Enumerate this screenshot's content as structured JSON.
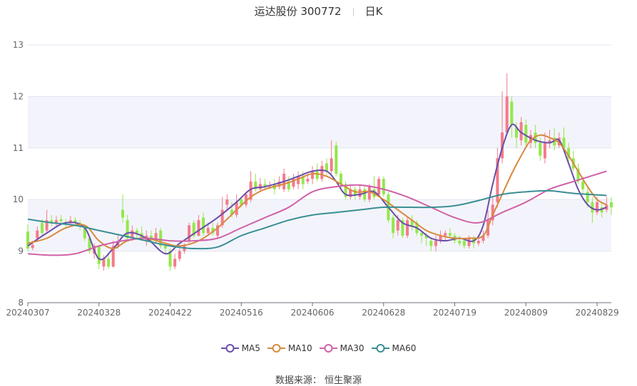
{
  "header": {
    "title": "运达股份 300772",
    "period": "日K"
  },
  "source_text": "数据来源： 恒生聚源",
  "colors": {
    "up": "#f47a8a",
    "down": "#92e84c",
    "MA5": "#6a4ea8",
    "MA10": "#d8893e",
    "MA30": "#d062a8",
    "MA60": "#3a8e94",
    "band": "#f3f4fb",
    "grid": "#e0e6f0"
  },
  "chart_data": {
    "type": "candlestick",
    "y_ticks": [
      "8",
      "9",
      "10",
      "11",
      "12",
      "13"
    ],
    "ylim": [
      8,
      13
    ],
    "x_tick_labels": [
      "20240307",
      "20240328",
      "20240422",
      "20240516",
      "20240606",
      "20240628",
      "20240719",
      "20240809",
      "20240829"
    ],
    "x_tick_index": [
      0,
      15,
      30,
      45,
      60,
      75,
      90,
      105,
      120
    ],
    "candles": [
      [
        9.38,
        9.05,
        9.52,
        9.0
      ],
      [
        9.06,
        9.12,
        9.2,
        9.02
      ],
      [
        9.25,
        9.4,
        9.48,
        9.2
      ],
      [
        9.55,
        9.35,
        9.62,
        9.3
      ],
      [
        9.4,
        9.6,
        9.8,
        9.35
      ],
      [
        9.6,
        9.55,
        9.7,
        9.48
      ],
      [
        9.55,
        9.6,
        9.68,
        9.48
      ],
      [
        9.62,
        9.58,
        9.7,
        9.5
      ],
      [
        9.55,
        9.52,
        9.62,
        9.45
      ],
      [
        9.55,
        9.6,
        9.68,
        9.5
      ],
      [
        9.6,
        9.55,
        9.66,
        9.48
      ],
      [
        9.55,
        9.5,
        9.6,
        9.4
      ],
      [
        9.45,
        9.25,
        9.5,
        9.2
      ],
      [
        9.25,
        9.0,
        9.3,
        8.95
      ],
      [
        8.95,
        9.1,
        9.15,
        8.85
      ],
      [
        9.1,
        8.75,
        9.12,
        8.65
      ],
      [
        8.7,
        8.85,
        8.92,
        8.62
      ],
      [
        8.85,
        8.7,
        8.95,
        8.65
      ],
      [
        8.7,
        9.1,
        9.2,
        8.68
      ],
      [
        9.1,
        9.2,
        9.3,
        9.05
      ],
      [
        9.8,
        9.65,
        10.1,
        9.55
      ],
      [
        9.6,
        9.25,
        9.7,
        9.2
      ],
      [
        9.25,
        9.4,
        9.5,
        9.2
      ],
      [
        9.4,
        9.35,
        9.45,
        9.25
      ],
      [
        9.35,
        9.25,
        9.48,
        9.2
      ],
      [
        9.2,
        9.3,
        9.4,
        9.1
      ],
      [
        9.3,
        9.2,
        9.4,
        9.15
      ],
      [
        9.2,
        9.35,
        9.45,
        9.15
      ],
      [
        9.4,
        9.1,
        9.45,
        9.05
      ],
      [
        9.1,
        9.05,
        9.15,
        8.95
      ],
      [
        9.0,
        8.7,
        9.05,
        8.62
      ],
      [
        8.7,
        8.85,
        8.95,
        8.65
      ],
      [
        8.85,
        9.0,
        9.05,
        8.8
      ],
      [
        9.0,
        9.1,
        9.15,
        8.95
      ],
      [
        9.2,
        9.5,
        9.55,
        9.15
      ],
      [
        9.55,
        9.3,
        9.6,
        9.25
      ],
      [
        9.3,
        9.6,
        9.7,
        9.28
      ],
      [
        9.65,
        9.35,
        9.75,
        9.3
      ],
      [
        9.35,
        9.45,
        9.55,
        9.3
      ],
      [
        9.45,
        9.35,
        9.55,
        9.3
      ],
      [
        9.3,
        9.5,
        9.55,
        9.25
      ],
      [
        9.5,
        9.8,
        10.05,
        9.45
      ],
      [
        9.9,
        10.0,
        10.1,
        9.8
      ],
      [
        9.8,
        9.7,
        9.95,
        9.65
      ],
      [
        9.7,
        9.95,
        10.1,
        9.65
      ],
      [
        10.0,
        9.9,
        10.05,
        9.85
      ],
      [
        9.9,
        10.1,
        10.15,
        9.85
      ],
      [
        10.0,
        10.35,
        10.55,
        9.95
      ],
      [
        10.35,
        10.2,
        10.5,
        10.15
      ],
      [
        10.2,
        10.3,
        10.42,
        10.15
      ],
      [
        10.3,
        10.25,
        10.4,
        10.18
      ],
      [
        10.25,
        10.25,
        10.35,
        10.2
      ],
      [
        10.3,
        10.2,
        10.4,
        10.1
      ],
      [
        10.25,
        10.35,
        10.45,
        10.2
      ],
      [
        10.2,
        10.5,
        10.6,
        10.15
      ],
      [
        10.35,
        10.2,
        10.45,
        10.15
      ],
      [
        10.25,
        10.4,
        10.5,
        10.2
      ],
      [
        10.3,
        10.45,
        10.55,
        10.2
      ],
      [
        10.45,
        10.3,
        10.55,
        10.2
      ],
      [
        10.35,
        10.4,
        10.5,
        10.3
      ],
      [
        10.4,
        10.55,
        10.65,
        10.3
      ],
      [
        10.55,
        10.4,
        10.7,
        10.35
      ],
      [
        10.4,
        10.65,
        10.75,
        10.35
      ],
      [
        10.7,
        10.55,
        10.8,
        10.45
      ],
      [
        10.55,
        10.8,
        11.15,
        10.5
      ],
      [
        11.05,
        10.5,
        11.12,
        10.45
      ],
      [
        10.5,
        10.3,
        10.55,
        10.2
      ],
      [
        10.3,
        10.05,
        10.35,
        10.0
      ],
      [
        10.05,
        10.2,
        10.3,
        10.0
      ],
      [
        10.2,
        10.1,
        10.25,
        10.0
      ],
      [
        10.05,
        10.2,
        10.3,
        10.0
      ],
      [
        10.2,
        10.0,
        10.25,
        9.95
      ],
      [
        10.0,
        10.25,
        10.3,
        9.95
      ],
      [
        10.2,
        10.05,
        10.45,
        10.0
      ],
      [
        10.1,
        10.4,
        10.45,
        10.05
      ],
      [
        10.4,
        10.1,
        10.45,
        10.05
      ],
      [
        10.1,
        9.6,
        10.15,
        9.55
      ],
      [
        9.65,
        9.35,
        9.7,
        9.25
      ],
      [
        9.4,
        9.6,
        9.7,
        9.3
      ],
      [
        9.6,
        9.3,
        9.65,
        9.25
      ],
      [
        9.3,
        9.6,
        9.65,
        9.25
      ],
      [
        9.6,
        9.5,
        9.7,
        9.4
      ],
      [
        9.55,
        9.35,
        9.6,
        9.3
      ],
      [
        9.35,
        9.3,
        9.4,
        9.15
      ],
      [
        9.3,
        9.25,
        9.35,
        9.1
      ],
      [
        9.2,
        9.1,
        9.25,
        9.0
      ],
      [
        9.1,
        9.2,
        9.3,
        9.0
      ],
      [
        9.2,
        9.3,
        9.4,
        9.15
      ],
      [
        9.3,
        9.35,
        9.4,
        9.2
      ],
      [
        9.35,
        9.3,
        9.45,
        9.25
      ],
      [
        9.3,
        9.2,
        9.35,
        9.15
      ],
      [
        9.2,
        9.15,
        9.3,
        9.1
      ],
      [
        9.2,
        9.1,
        9.25,
        9.05
      ],
      [
        9.1,
        9.25,
        9.3,
        9.05
      ],
      [
        9.25,
        9.15,
        9.3,
        9.05
      ],
      [
        9.15,
        9.2,
        9.3,
        9.1
      ],
      [
        9.2,
        9.3,
        9.4,
        9.15
      ],
      [
        9.3,
        9.6,
        9.8,
        9.25
      ],
      [
        9.6,
        9.9,
        10.05,
        9.5
      ],
      [
        9.95,
        10.8,
        11.0,
        9.85
      ],
      [
        10.8,
        11.3,
        12.1,
        10.7
      ],
      [
        11.3,
        12.0,
        12.45,
        11.25
      ],
      [
        11.9,
        11.45,
        12.0,
        11.2
      ],
      [
        11.4,
        11.2,
        11.5,
        11.0
      ],
      [
        11.15,
        11.5,
        11.6,
        11.05
      ],
      [
        11.45,
        11.1,
        11.55,
        11.0
      ],
      [
        11.1,
        11.25,
        11.35,
        11.0
      ],
      [
        11.3,
        11.1,
        11.45,
        11.0
      ],
      [
        11.1,
        10.85,
        11.2,
        10.75
      ],
      [
        10.8,
        11.1,
        11.3,
        10.7
      ],
      [
        11.1,
        11.15,
        11.35,
        11.0
      ],
      [
        11.2,
        11.05,
        11.38,
        10.95
      ],
      [
        11.05,
        11.2,
        11.3,
        11.0
      ],
      [
        11.2,
        11.0,
        11.4,
        10.95
      ],
      [
        11.0,
        10.8,
        11.1,
        10.7
      ],
      [
        10.8,
        10.6,
        10.95,
        10.55
      ],
      [
        10.6,
        10.35,
        10.7,
        10.3
      ],
      [
        10.35,
        10.2,
        10.45,
        10.1
      ],
      [
        10.15,
        9.95,
        10.25,
        9.85
      ],
      [
        9.95,
        9.75,
        10.05,
        9.55
      ],
      [
        9.75,
        9.95,
        10.05,
        9.7
      ],
      [
        9.85,
        9.75,
        9.95,
        9.65
      ],
      [
        9.8,
        9.9,
        10.05,
        9.75
      ],
      [
        9.95,
        9.85,
        10.05,
        9.7
      ]
    ],
    "series": [
      {
        "name": "MA5",
        "points": [
          [
            0,
            9.1
          ],
          [
            4,
            9.35
          ],
          [
            8,
            9.55
          ],
          [
            12,
            9.45
          ],
          [
            15,
            8.85
          ],
          [
            18,
            9.05
          ],
          [
            21,
            9.35
          ],
          [
            25,
            9.25
          ],
          [
            29,
            8.95
          ],
          [
            32,
            9.15
          ],
          [
            36,
            9.4
          ],
          [
            40,
            9.65
          ],
          [
            44,
            9.95
          ],
          [
            47,
            10.2
          ],
          [
            50,
            10.25
          ],
          [
            54,
            10.35
          ],
          [
            57,
            10.45
          ],
          [
            60,
            10.55
          ],
          [
            63,
            10.55
          ],
          [
            65,
            10.35
          ],
          [
            67,
            10.1
          ],
          [
            70,
            10.1
          ],
          [
            73,
            10.15
          ],
          [
            76,
            9.85
          ],
          [
            79,
            9.55
          ],
          [
            82,
            9.45
          ],
          [
            85,
            9.25
          ],
          [
            88,
            9.2
          ],
          [
            91,
            9.25
          ],
          [
            94,
            9.2
          ],
          [
            96,
            9.5
          ],
          [
            98,
            10.3
          ],
          [
            100,
            11.0
          ],
          [
            102,
            11.45
          ],
          [
            104,
            11.3
          ],
          [
            107,
            11.15
          ],
          [
            110,
            11.1
          ],
          [
            112,
            11.15
          ],
          [
            114,
            10.7
          ],
          [
            116,
            10.2
          ],
          [
            118,
            9.9
          ],
          [
            120,
            9.8
          ],
          [
            122,
            9.85
          ]
        ]
      },
      {
        "name": "MA10",
        "points": [
          [
            0,
            9.15
          ],
          [
            4,
            9.25
          ],
          [
            8,
            9.45
          ],
          [
            12,
            9.5
          ],
          [
            15,
            9.2
          ],
          [
            18,
            9.05
          ],
          [
            21,
            9.2
          ],
          [
            25,
            9.25
          ],
          [
            29,
            9.15
          ],
          [
            32,
            9.1
          ],
          [
            36,
            9.2
          ],
          [
            40,
            9.45
          ],
          [
            44,
            9.8
          ],
          [
            47,
            10.05
          ],
          [
            50,
            10.2
          ],
          [
            54,
            10.3
          ],
          [
            57,
            10.4
          ],
          [
            60,
            10.5
          ],
          [
            63,
            10.45
          ],
          [
            66,
            10.3
          ],
          [
            69,
            10.15
          ],
          [
            72,
            10.15
          ],
          [
            75,
            10.0
          ],
          [
            78,
            9.8
          ],
          [
            81,
            9.6
          ],
          [
            84,
            9.4
          ],
          [
            87,
            9.3
          ],
          [
            90,
            9.25
          ],
          [
            93,
            9.25
          ],
          [
            96,
            9.3
          ],
          [
            98,
            9.7
          ],
          [
            100,
            10.1
          ],
          [
            102,
            10.5
          ],
          [
            104,
            10.85
          ],
          [
            106,
            11.15
          ],
          [
            108,
            11.25
          ],
          [
            110,
            11.2
          ],
          [
            112,
            11.1
          ],
          [
            114,
            10.85
          ],
          [
            116,
            10.55
          ],
          [
            118,
            10.25
          ],
          [
            120,
            10.0
          ],
          [
            122,
            9.9
          ]
        ]
      },
      {
        "name": "MA30",
        "points": [
          [
            0,
            8.95
          ],
          [
            5,
            8.92
          ],
          [
            10,
            8.95
          ],
          [
            15,
            9.1
          ],
          [
            20,
            9.2
          ],
          [
            25,
            9.25
          ],
          [
            30,
            9.2
          ],
          [
            35,
            9.2
          ],
          [
            40,
            9.25
          ],
          [
            45,
            9.45
          ],
          [
            50,
            9.65
          ],
          [
            55,
            9.85
          ],
          [
            60,
            10.15
          ],
          [
            65,
            10.25
          ],
          [
            70,
            10.28
          ],
          [
            75,
            10.2
          ],
          [
            80,
            10.05
          ],
          [
            85,
            9.85
          ],
          [
            90,
            9.65
          ],
          [
            95,
            9.55
          ],
          [
            100,
            9.75
          ],
          [
            105,
            9.95
          ],
          [
            110,
            10.2
          ],
          [
            115,
            10.35
          ],
          [
            122,
            10.55
          ]
        ]
      },
      {
        "name": "MA60",
        "points": [
          [
            0,
            9.62
          ],
          [
            5,
            9.55
          ],
          [
            10,
            9.5
          ],
          [
            15,
            9.4
          ],
          [
            20,
            9.3
          ],
          [
            25,
            9.2
          ],
          [
            30,
            9.1
          ],
          [
            35,
            9.05
          ],
          [
            40,
            9.08
          ],
          [
            45,
            9.3
          ],
          [
            50,
            9.45
          ],
          [
            55,
            9.6
          ],
          [
            60,
            9.7
          ],
          [
            65,
            9.75
          ],
          [
            70,
            9.8
          ],
          [
            75,
            9.85
          ],
          [
            80,
            9.85
          ],
          [
            85,
            9.85
          ],
          [
            90,
            9.88
          ],
          [
            95,
            9.98
          ],
          [
            100,
            10.1
          ],
          [
            105,
            10.15
          ],
          [
            110,
            10.17
          ],
          [
            115,
            10.12
          ],
          [
            122,
            10.08
          ]
        ]
      }
    ],
    "legend": [
      "MA5",
      "MA10",
      "MA30",
      "MA60"
    ]
  }
}
